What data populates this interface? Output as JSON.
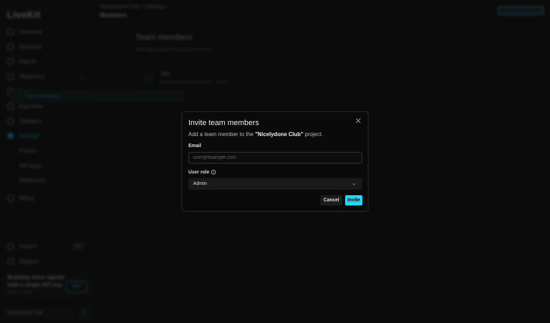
{
  "sidebar": {
    "logo": "LiveKit",
    "items": [
      {
        "label": "Overview"
      },
      {
        "label": "Sessions"
      },
      {
        "label": "Agents"
      },
      {
        "label": "Telephony"
      },
      {
        "label": "Egresses"
      },
      {
        "label": "Ingresses"
      },
      {
        "label": "Sandbox"
      },
      {
        "label": "Settings"
      }
    ],
    "settings_sub": [
      {
        "label": "Project"
      },
      {
        "label": "Team members"
      },
      {
        "label": "API keys"
      },
      {
        "label": "Webhooks"
      }
    ],
    "billing": "Billing",
    "search": "Search",
    "search_kbd": "⌘K",
    "support": "Support",
    "promo": {
      "text": "Building voice agents with a single API key.",
      "link": "Learn more",
      "badge": "STT"
    },
    "project": "Nicelydone Club",
    "project_btn": "P"
  },
  "header": {
    "breadcrumb": "Nicelydone Club  /  Settings  /",
    "title": "Members",
    "action": "Invite team member"
  },
  "main": {
    "title": "Team members",
    "subtitle": "Manage project access and roles.",
    "member": {
      "badge": "You",
      "email": "products@nicelydone.club · Admin"
    }
  },
  "modal": {
    "title": "Invite team members",
    "desc_pre": "Add a team member to the ",
    "desc_project": "\"Nicelydone Club\"",
    "desc_post": " project.",
    "email_label": "Email",
    "email_placeholder": "user@example.com",
    "role_label": "User role",
    "role_value": "Admin",
    "cancel": "Cancel",
    "invite": "Invite",
    "close": "✕",
    "info": "i",
    "chevron": "⌄"
  }
}
